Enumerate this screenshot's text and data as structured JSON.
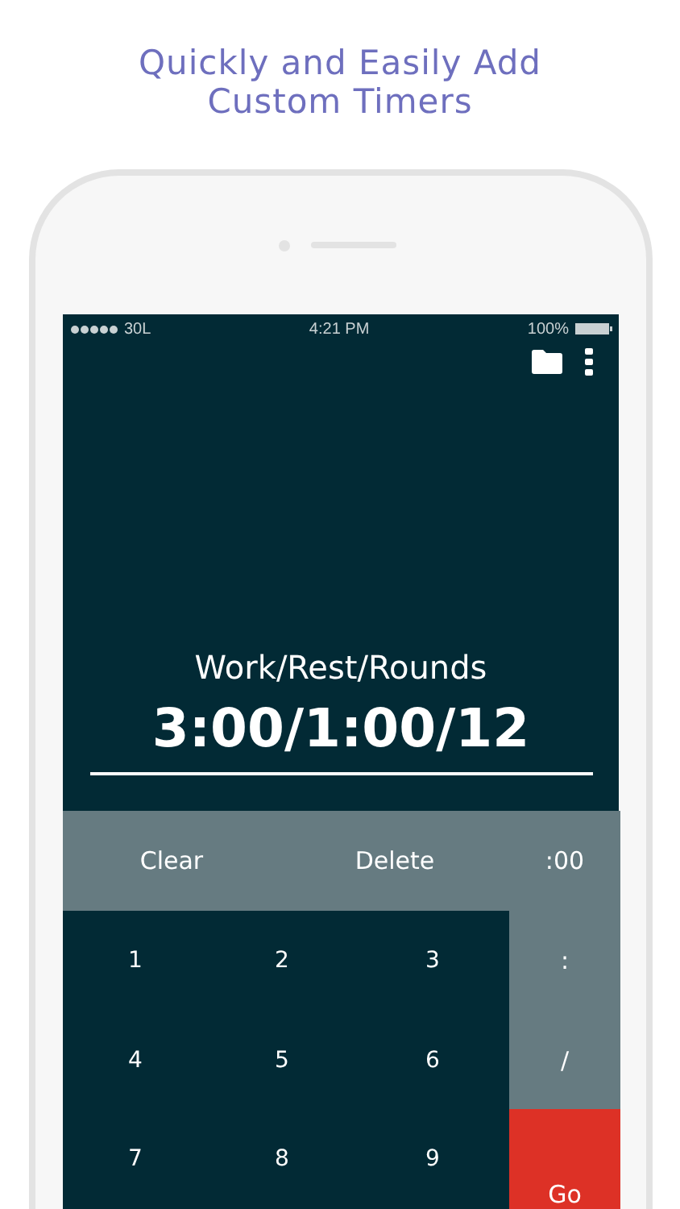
{
  "headline_lines": [
    "Quickly and Easily Add",
    "Custom Timers"
  ],
  "status_bar": {
    "carrier": "30L",
    "time": "4:21 PM",
    "battery": "100%"
  },
  "display": {
    "label": "Work/Rest/Rounds",
    "value": "3:00/1:00/12"
  },
  "top_keys": [
    {
      "label": "Clear",
      "kind": "function"
    },
    {
      "label": "Delete",
      "kind": "function"
    },
    {
      "label": ":00",
      "kind": "function"
    }
  ],
  "digit_keys": [
    "1",
    "2",
    "3",
    "4",
    "5",
    "6",
    "7",
    "8",
    "9"
  ],
  "side_keys": [
    {
      "label": ":",
      "kind": "operator"
    },
    {
      "label": "/",
      "kind": "operator"
    },
    {
      "label": "Go",
      "kind": "go"
    }
  ]
}
